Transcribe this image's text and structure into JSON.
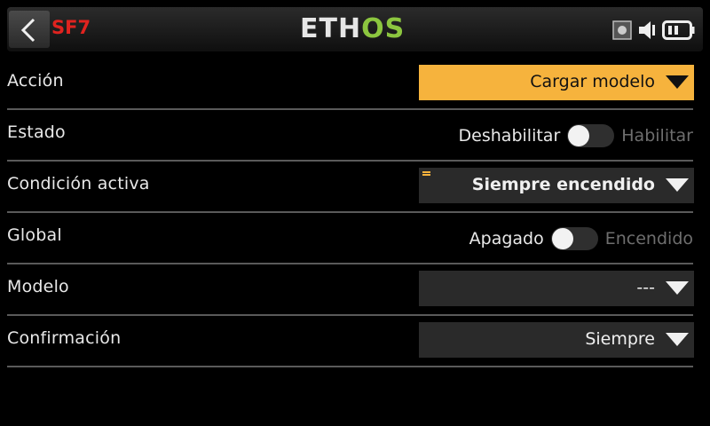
{
  "header": {
    "title": "SF7",
    "logo_main": "ETH",
    "logo_accent": "OS"
  },
  "rows": [
    {
      "label": "Acción",
      "type": "dropdown",
      "value": "Cargar modelo",
      "highlighted": true
    },
    {
      "label": "Estado",
      "type": "toggle",
      "off_label": "Deshabilitar",
      "on_label": "Habilitar",
      "state": "off"
    },
    {
      "label": "Condición activa",
      "type": "dropdown",
      "value": "Siempre encendido"
    },
    {
      "label": "Global",
      "type": "toggle",
      "off_label": "Apagado",
      "on_label": "Encendido",
      "state": "off"
    },
    {
      "label": "Modelo",
      "type": "dropdown",
      "value": "---"
    },
    {
      "label": "Confirmación",
      "type": "dropdown",
      "value": "Siempre"
    }
  ],
  "colors": {
    "accent": "#f6b33d",
    "title_red": "#e0231f",
    "logo_green": "#8cc63f"
  },
  "icons": [
    "back-arrow-icon",
    "sd-card-icon",
    "speaker-icon",
    "battery-icon",
    "dropdown-arrow-icon",
    "condition-list-icon"
  ]
}
